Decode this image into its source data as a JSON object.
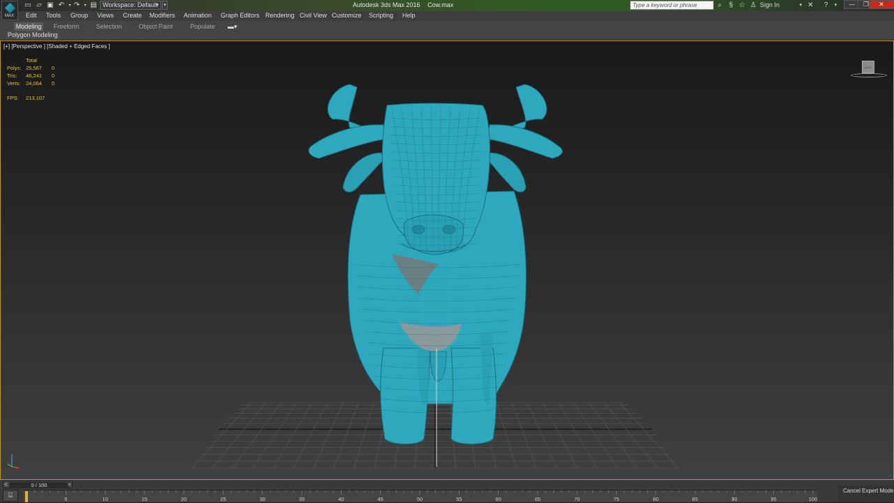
{
  "app": {
    "logo_text": "MAX",
    "title": "Autodesk 3ds Max 2016",
    "file": "Cow.max",
    "workspace": "Workspace: Default"
  },
  "search": {
    "placeholder": "Type a keyword or phrase"
  },
  "account": {
    "sign_in": "Sign In"
  },
  "menu": [
    "Edit",
    "Tools",
    "Group",
    "Views",
    "Create",
    "Modifiers",
    "Animation",
    "Graph Editors",
    "Rendering",
    "Civil View",
    "Customize",
    "Scripting",
    "Help"
  ],
  "ribbon": {
    "tabs": [
      "Modeling",
      "Freeform",
      "Selection",
      "Object Paint",
      "Populate"
    ],
    "active_tab": "Modeling",
    "panel": "Polygon Modeling"
  },
  "viewport": {
    "label": "[+] [Perspective ] [Shaded + Edged Faces ]",
    "stats": {
      "header": "Total",
      "rows": [
        {
          "name": "Polys:",
          "total": "25,567",
          "selected": "0"
        },
        {
          "name": "Tris:",
          "total": "46,241",
          "selected": "0"
        },
        {
          "name": "Verts:",
          "total": "24,064",
          "selected": "0"
        }
      ],
      "fps_label": "FPS:",
      "fps_value": "213.107"
    },
    "model_color": "#2ea8bd",
    "viewcube_label": "BACK"
  },
  "timeline": {
    "frame_readout": "0 / 100",
    "prev": "<",
    "next": ">",
    "ticks": [
      "5",
      "10",
      "15",
      "20",
      "25",
      "30",
      "35",
      "40",
      "45",
      "50",
      "55",
      "60",
      "65",
      "70",
      "75",
      "80",
      "85",
      "90",
      "95",
      "100"
    ]
  },
  "status": {
    "cancel_expert": "Cancel Expert Mode"
  }
}
